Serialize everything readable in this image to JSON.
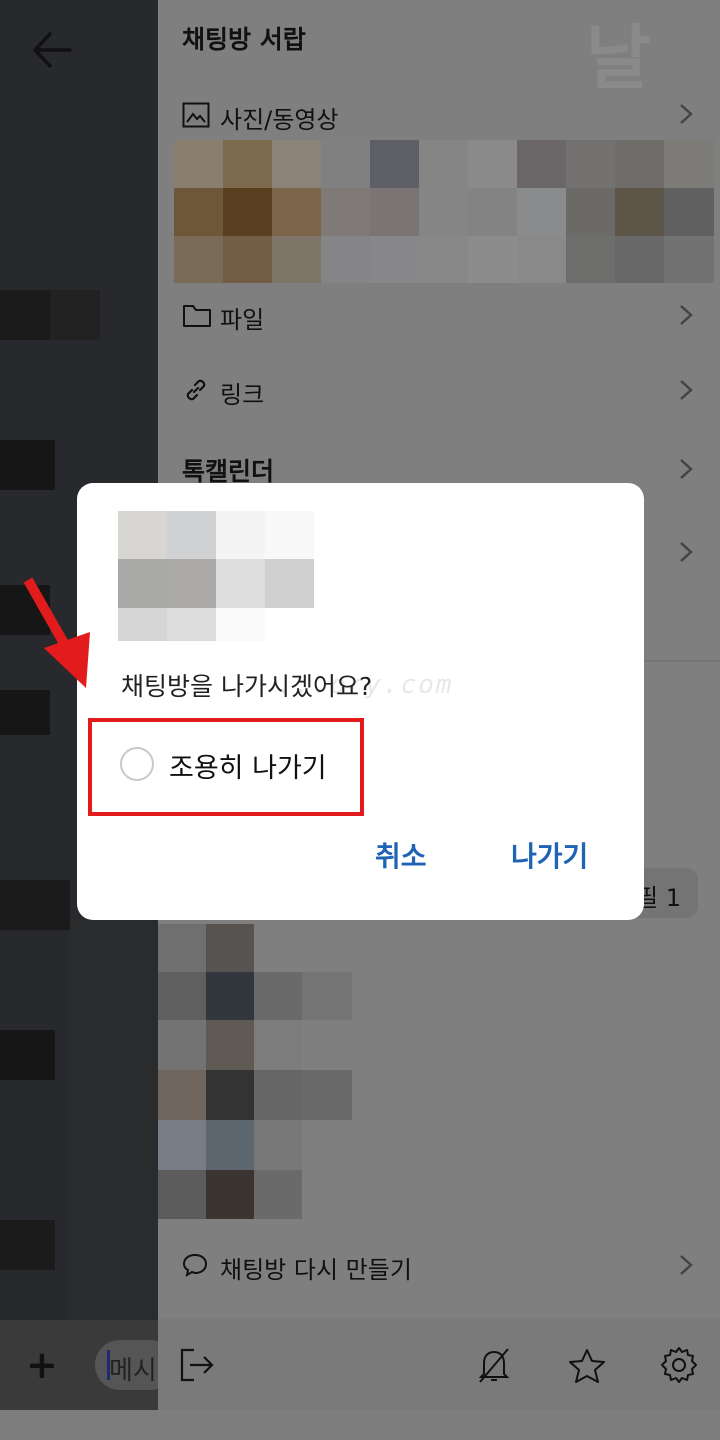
{
  "drawer": {
    "title": "채팅방 서랍",
    "rows": {
      "photos": "사진/동영상",
      "files": "파일",
      "links": "링크",
      "calendar": "톡캘린더",
      "profile_partial": "필 1",
      "recreate": "채팅방 다시 만들기"
    }
  },
  "input": {
    "placeholder_partial": "메시"
  },
  "dialog": {
    "question": "채팅방을 나가시겠어요?",
    "watermark": "...ory.com",
    "quiet_leave_label": "조용히 나가기",
    "quiet_leave_checked": false,
    "cancel_label": "취소",
    "leave_label": "나가기"
  },
  "colors": {
    "accent": "#1f63b4",
    "highlight": "#e21c1c",
    "scrim": "#7f7f7f"
  },
  "icons": [
    "back-arrow-icon",
    "image-icon",
    "folder-icon",
    "link-icon",
    "chevron-right-icon",
    "chat-bubble-icon",
    "exit-icon",
    "bell-off-icon",
    "star-icon",
    "gear-icon",
    "plus-icon",
    "red-arrow-annotation"
  ]
}
